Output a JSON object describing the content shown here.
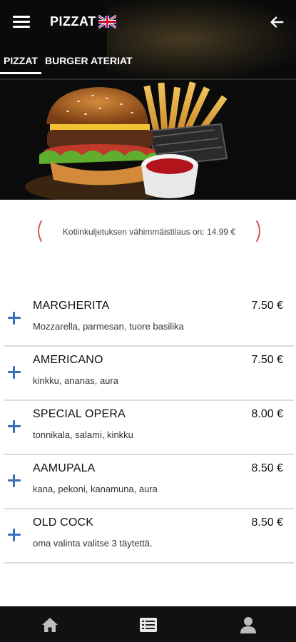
{
  "header": {
    "title": "PIZZAT",
    "language_icon": "uk-flag-icon"
  },
  "tabs": [
    {
      "label": "PIZZAT",
      "active": true
    },
    {
      "label": "BURGER ATERIAT",
      "active": false
    }
  ],
  "notice": {
    "text": "Kotiinkuljetuksen vähimmäistilaus on: 14.99 €"
  },
  "items": [
    {
      "name": "MARGHERITA",
      "description": "Mozzarella, parmesan, tuore basilika",
      "price": "7.50 €"
    },
    {
      "name": "AMERICANO",
      "description": "kinkku, ananas, aura",
      "price": "7.50 €"
    },
    {
      "name": "SPECIAL OPERA",
      "description": "tonnikala, salami, kinkku",
      "price": "8.00 €"
    },
    {
      "name": "AAMUPALA",
      "description": "kana, pekoni, kanamuna, aura",
      "price": "8.50 €"
    },
    {
      "name": "OLD COCK",
      "description": "oma valinta valitse 3 täytettä.",
      "price": "8.50 €"
    }
  ],
  "bottom_nav": [
    {
      "icon": "home-icon"
    },
    {
      "icon": "menu-list-icon"
    },
    {
      "icon": "user-icon"
    }
  ],
  "colors": {
    "accent_blue": "#3a6fb8",
    "notice_red": "#d9534f",
    "dark": "#111111"
  }
}
